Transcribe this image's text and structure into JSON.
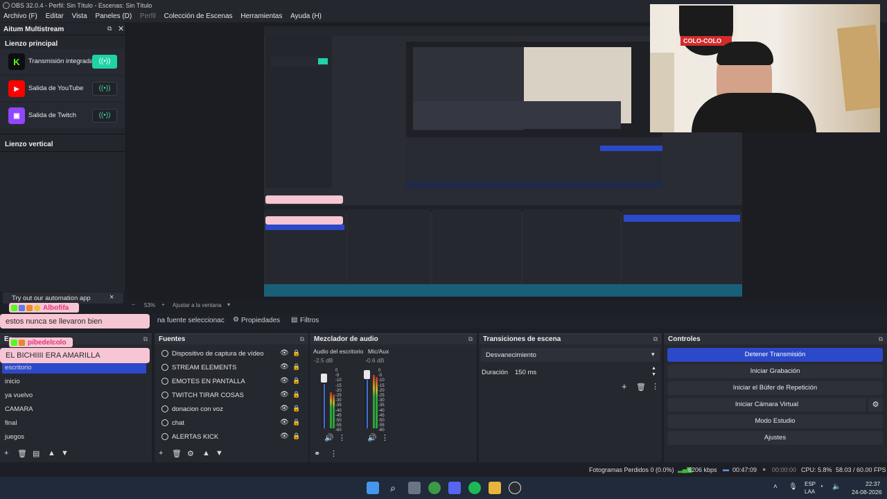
{
  "window": {
    "title": "OBS 32.0.4 - Perfil: Sin Título - Escenas: Sin Título"
  },
  "menu": [
    "Archivo (F)",
    "Editar",
    "Vista",
    "Paneles (D)",
    "Perfil",
    "Colección de Escenas",
    "Herramientas",
    "Ayuda (H)"
  ],
  "multistream": {
    "title": "Aitum Multistream",
    "main_canvas": "Lienzo principal",
    "vertical_canvas": "Lienzo vertical",
    "outputs": [
      {
        "label": "Transmisión integrada",
        "icon": "kick-icon",
        "color": "#53fc18",
        "active": true
      },
      {
        "label": "Salida de YouTube",
        "icon": "youtube-icon",
        "color": "#ff0000",
        "active": false
      },
      {
        "label": "Salida de Twitch",
        "icon": "twitch-icon",
        "color": "#9146ff",
        "active": false
      }
    ]
  },
  "automation": {
    "text": "Try out our automation app",
    "close": "×"
  },
  "zoom": {
    "value": "53%",
    "fit": "Ajustar a la ventana"
  },
  "chat": [
    {
      "user": "Albofifa",
      "message": "estos nunca se llevaron bien"
    },
    {
      "user": "pibedelcolo",
      "message": "EL BICHIIII ERA AMARILLA"
    }
  ],
  "props_bar": {
    "no_source": "na fuente seleccionac",
    "properties": "Propiedades",
    "filters": "Filtros"
  },
  "scenes": {
    "title": "Es",
    "items": [
      "escritorio",
      "inicio",
      "ya vuelvo",
      "CAMARA",
      "final",
      "juegos"
    ],
    "selected": 0
  },
  "sources": {
    "title": "Fuentes",
    "items": [
      "Dispositivo de captura de vídeo",
      "STREAM ELEMENTS",
      "EMOTES EN PANTALLA",
      "TWITCH TIRAR COSAS",
      "donacion con voz",
      "chat",
      "ALERTAS KICK"
    ]
  },
  "mixer": {
    "title": "Mezclador de audio",
    "channels": [
      {
        "name": "Audio del escritorio",
        "db": "-2.5 dB",
        "level": 0.6
      },
      {
        "name": "Mic/Aux",
        "db": "-0.6 dB",
        "level": 0.9
      }
    ],
    "scale": [
      "0",
      "-5",
      "-10",
      "-15",
      "-20",
      "-25",
      "-30",
      "-35",
      "-40",
      "-45",
      "-50",
      "-55",
      "-60"
    ]
  },
  "transitions": {
    "title": "Transiciones de escena",
    "selected": "Desvanecimiento",
    "duration_label": "Duración",
    "duration_value": "150 ms"
  },
  "controls": {
    "title": "Controles",
    "buttons": [
      "Detener Transmisión",
      "Iniciar Grabación",
      "Iniciar el Búfer de Repetición",
      "Iniciar Cámara Virtual",
      "Modo Estudio",
      "Ajustes"
    ]
  },
  "status": {
    "dropped": "Fotogramas Perdidos 0 (0.0%)",
    "bitrate": "6206 kbps",
    "stream_time": "00:47:09",
    "rec_time": "00:00:00",
    "cpu": "CPU: 5.8%",
    "fps": "58.03 / 60.00 FPS"
  },
  "taskbar": {
    "lang1": "ESP",
    "lang2": "LAA",
    "time": "22:37",
    "date": "24-08-2026"
  },
  "webcam": {
    "sign": "COLO-COLO"
  },
  "colors": {
    "accent_blue": "#2c49c9",
    "kick_green": "#1fd3a6",
    "chat_pink": "#f7c6d4"
  }
}
